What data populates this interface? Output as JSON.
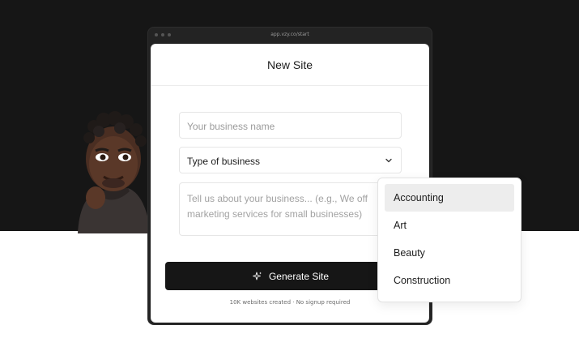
{
  "browser": {
    "url": "app.vzy.co/start"
  },
  "card": {
    "title": "New Site"
  },
  "form": {
    "name_placeholder": "Your business name",
    "type_value": "Type of business",
    "description_placeholder": "Tell us about your business... (e.g., We offer marketing services for small businesses)",
    "description_line1": "Tell us about your business... (e.g., We off",
    "description_line2": "marketing services for small businesses)"
  },
  "generate_button": {
    "label": "Generate Site",
    "icon": "sparkle-icon"
  },
  "footnote": "10K websites created · No signup required",
  "dropdown": {
    "options": [
      "Accounting",
      "Art",
      "Beauty",
      "Construction"
    ],
    "highlighted": "Accounting"
  },
  "colors": {
    "dark_bg": "#161616",
    "button_bg": "#161616",
    "highlight": "#ededed"
  }
}
